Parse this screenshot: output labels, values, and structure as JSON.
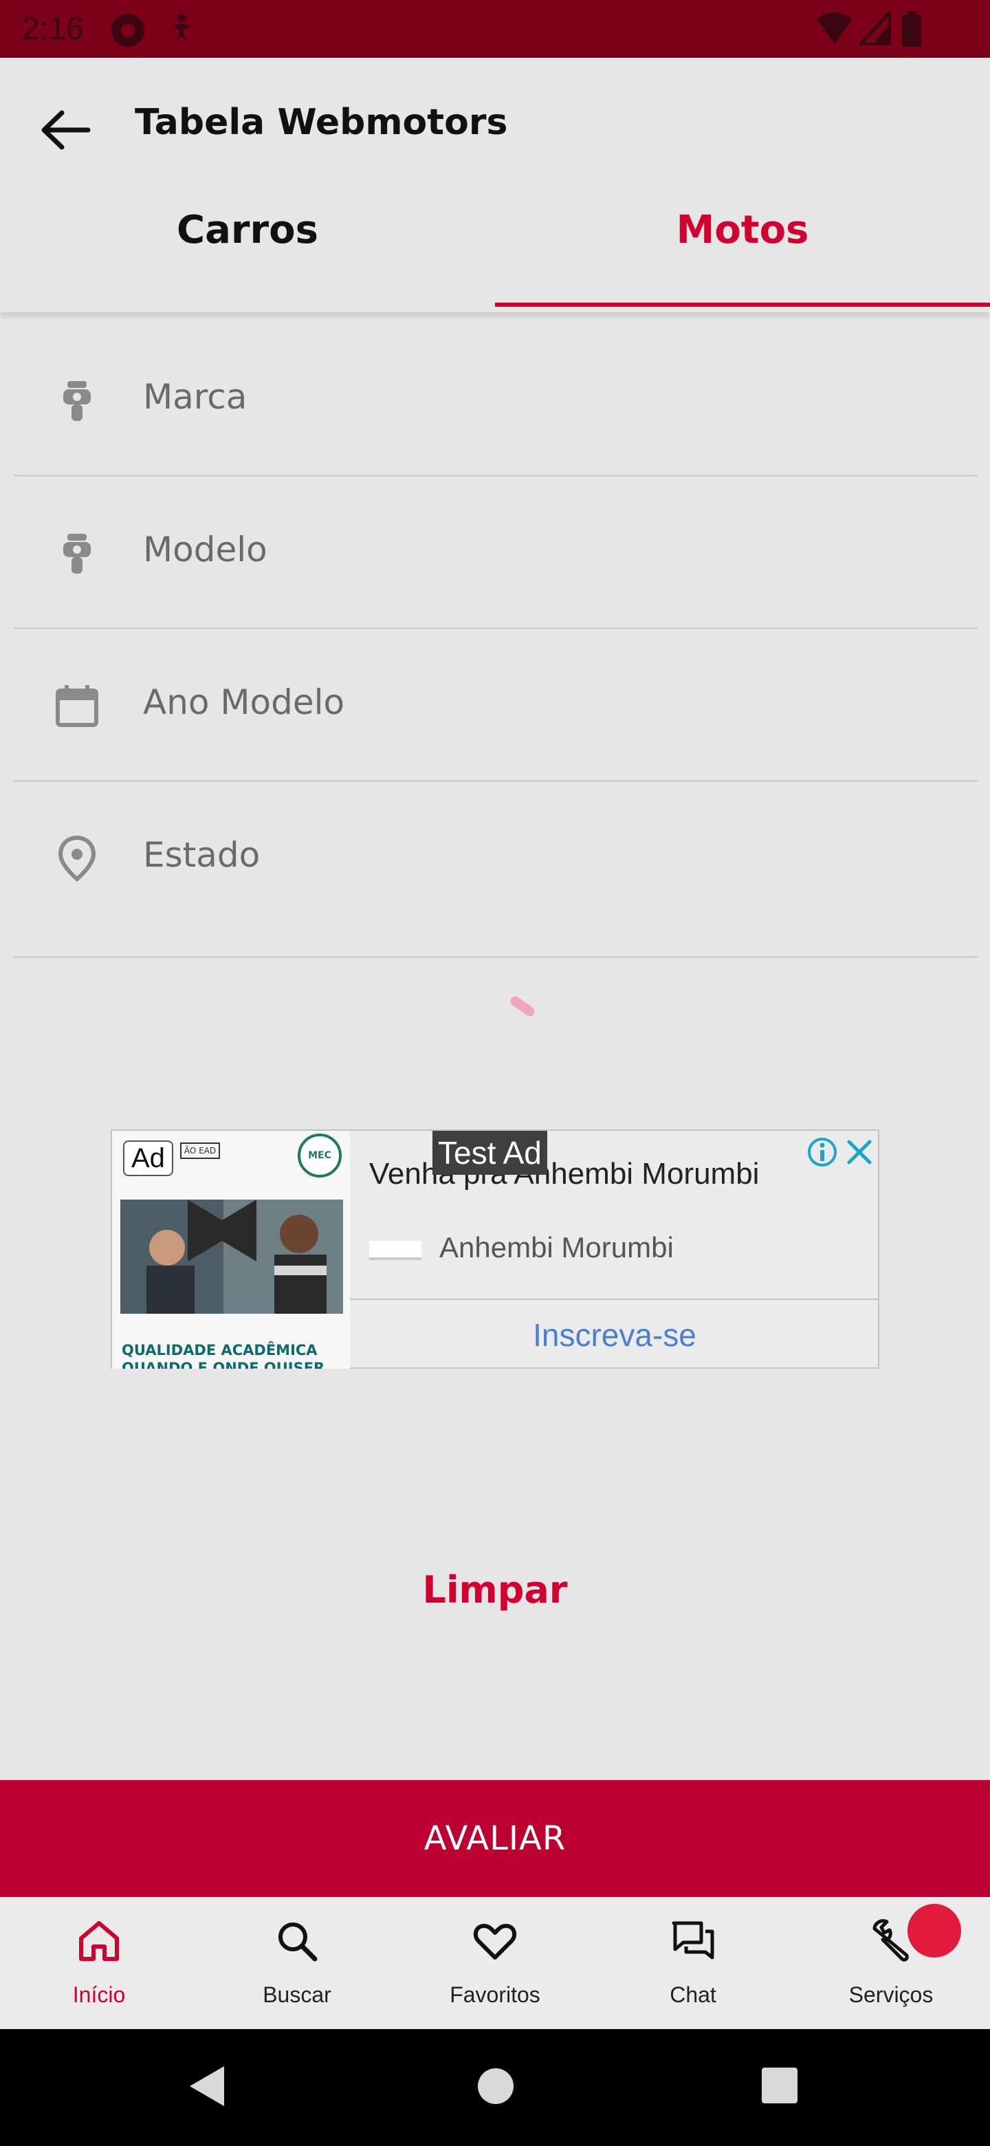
{
  "status_bar": {
    "time": "2:16"
  },
  "app_bar": {
    "title": "Tabela Webmotors",
    "tabs": [
      {
        "label": "Carros",
        "selected": false
      },
      {
        "label": "Motos",
        "selected": true
      }
    ]
  },
  "form": {
    "fields": [
      {
        "label": "Marca",
        "icon": "motorcycle-icon"
      },
      {
        "label": "Modelo",
        "icon": "motorcycle-icon"
      },
      {
        "label": "Ano Modelo",
        "icon": "calendar-icon"
      },
      {
        "label": "Estado",
        "icon": "location-pin-icon"
      }
    ]
  },
  "ad": {
    "badge": "Ad",
    "test_label": "Test Ad",
    "headline": "Venha pra Anhembi Morumbi",
    "advertiser": "Anhembi Morumbi",
    "cta": "Inscreva-se",
    "image_caption": "QUALIDADE ACADÊMICA QUANDO E ONDE QUISER",
    "image_tag": "ÃO EAD",
    "seal_text": "MEC"
  },
  "actions": {
    "clear_label": "Limpar",
    "submit_label": "AVALIAR"
  },
  "bottom_nav": {
    "items": [
      {
        "label": "Início",
        "icon": "home-icon",
        "active": true
      },
      {
        "label": "Buscar",
        "icon": "search-icon",
        "active": false
      },
      {
        "label": "Favoritos",
        "icon": "heart-icon",
        "active": false
      },
      {
        "label": "Chat",
        "icon": "chat-icon",
        "active": false
      },
      {
        "label": "Serviços",
        "icon": "wrench-icon",
        "active": false
      }
    ]
  },
  "colors": {
    "accent": "#d2002f",
    "primary_button": "#bc0032",
    "status_bar": "#7d0019",
    "background": "#e6e6e6"
  }
}
